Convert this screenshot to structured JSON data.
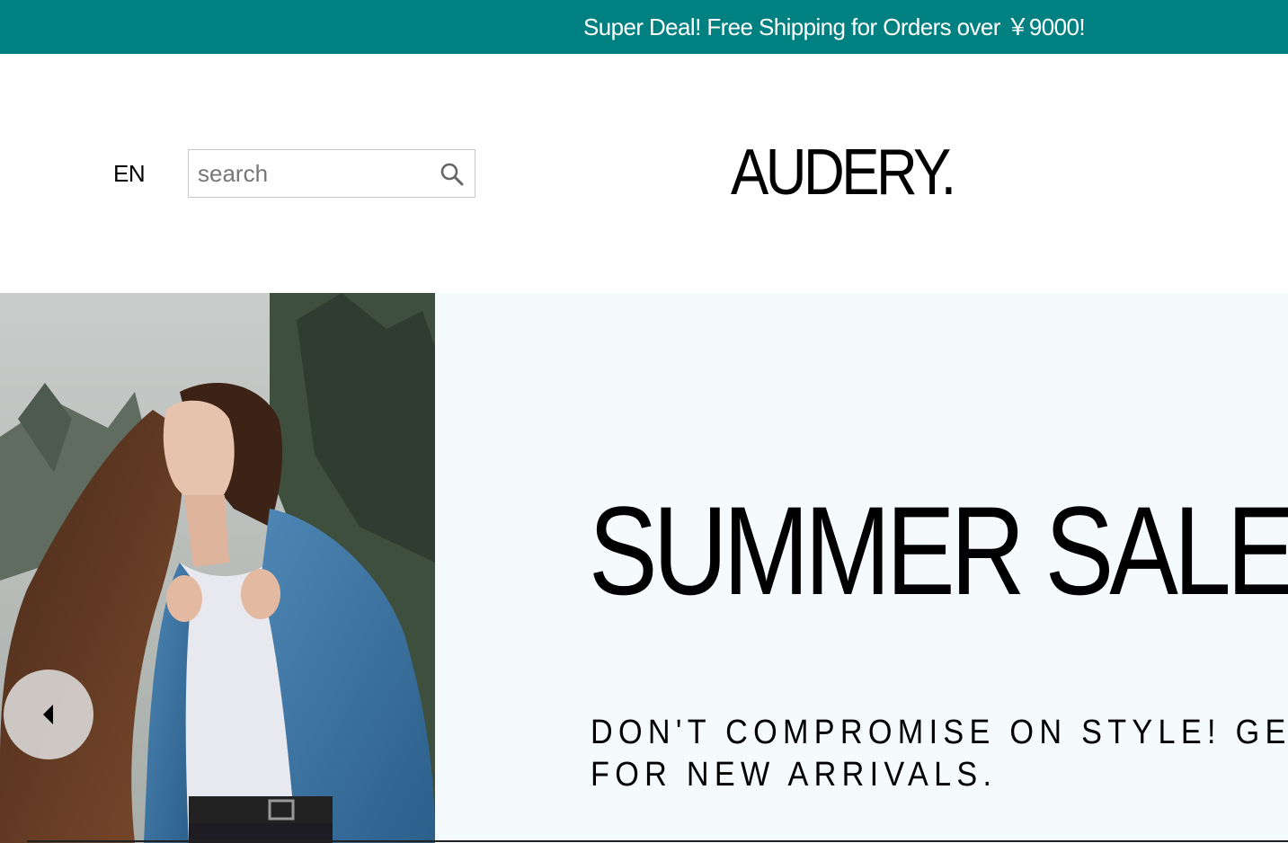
{
  "announcement": {
    "text": "Super Deal! Free Shipping for Orders over ￥9000!",
    "background_color": "#008080"
  },
  "header": {
    "language": "EN",
    "search": {
      "placeholder": "search",
      "value": "",
      "icon": "search-icon"
    },
    "logo": "AUDERY."
  },
  "hero": {
    "title": "SUMMER SALE",
    "description": "DON'T COMPROMISE ON STYLE! GET FOR NEW ARRIVALS.",
    "background_color": "#f5fafd",
    "image_alt": "woman in denim jacket",
    "prev_icon": "chevron-left-icon"
  }
}
